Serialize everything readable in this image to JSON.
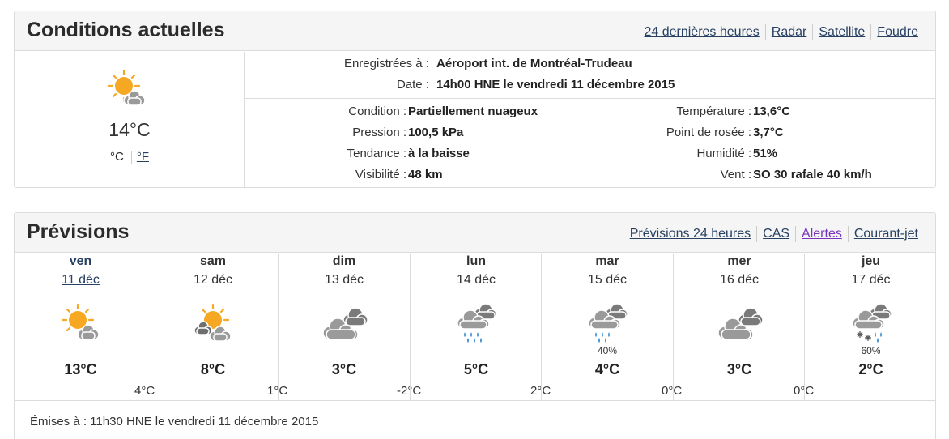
{
  "current": {
    "title": "Conditions actuelles",
    "links": [
      "24 dernières heures",
      "Radar",
      "Satellite",
      "Foudre"
    ],
    "icon": "sun-cloud-icon",
    "temp": "14°C",
    "unit_c": "°C",
    "unit_f": "°F",
    "recorded_label": "Enregistrées à :",
    "recorded_value": "Aéroport int. de Montréal-Trudeau",
    "date_label": "Date :",
    "date_value": "14h00 HNE le vendredi 11 décembre 2015",
    "condition_label": "Condition :",
    "condition_value": "Partiellement nuageux",
    "pressure_label": "Pression :",
    "pressure_value": "100,5 kPa",
    "tendency_label": "Tendance :",
    "tendency_value": "à la baisse",
    "visibility_label": "Visibilité :",
    "visibility_value": "48 km",
    "temperature_label": "Température :",
    "temperature_value": "13,6°C",
    "dewpoint_label": "Point de rosée :",
    "dewpoint_value": "3,7°C",
    "humidity_label": "Humidité :",
    "humidity_value": "51%",
    "wind_label": "Vent :",
    "wind_value": "SO 30 rafale 40 km/h"
  },
  "forecast": {
    "title": "Prévisions",
    "links": [
      "Prévisions 24 heures",
      "CAS",
      "Alertes",
      "Courant-jet"
    ],
    "days": [
      {
        "name": "ven",
        "date": "11 déc",
        "icon": "sun-cloud-icon",
        "pop": "",
        "high": "13°C",
        "low": "4°C"
      },
      {
        "name": "sam",
        "date": "12 déc",
        "icon": "sun-clouds-icon",
        "pop": "",
        "high": "8°C",
        "low": "1°C"
      },
      {
        "name": "dim",
        "date": "13 déc",
        "icon": "cloudy-icon",
        "pop": "",
        "high": "3°C",
        "low": "-2°C"
      },
      {
        "name": "lun",
        "date": "14 déc",
        "icon": "rain-icon",
        "pop": "",
        "high": "5°C",
        "low": "2°C"
      },
      {
        "name": "mar",
        "date": "15 déc",
        "icon": "rain-icon",
        "pop": "40%",
        "high": "4°C",
        "low": "0°C"
      },
      {
        "name": "mer",
        "date": "16 déc",
        "icon": "cloudy-icon",
        "pop": "",
        "high": "3°C",
        "low": "0°C"
      },
      {
        "name": "jeu",
        "date": "17 déc",
        "icon": "rain-snow-icon",
        "pop": "60%",
        "high": "2°C",
        "low": ""
      }
    ],
    "issued": "Émises à : 11h30 HNE le vendredi 11 décembre 2015"
  },
  "colors": {
    "link": "#284162",
    "visited": "#7834bc",
    "sun": "#f7a823",
    "cloud": "#8c8c8c",
    "rain": "#3e8fd6"
  }
}
